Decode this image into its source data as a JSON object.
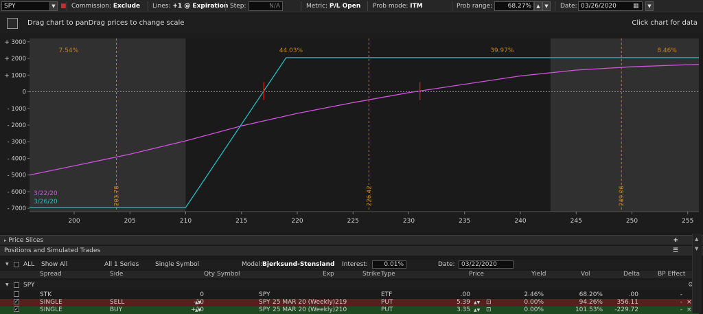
{
  "toolbar": {
    "symbol": "SPY",
    "commission_label": "Commission:",
    "commission_value": "Exclude",
    "lines_label": "Lines:",
    "lines_value": "+1 @ Expiration",
    "step_label": "Step:",
    "step_value": "N/A",
    "metric_label": "Metric:",
    "metric_value": "P/L Open",
    "probmode_label": "Prob mode:",
    "probmode_value": "ITM",
    "probrange_label": "Prob range:",
    "probrange_value": "68.27%",
    "date_label": "Date:",
    "date_value": "03/26/2020"
  },
  "header": {
    "drag_text": "Drag chart to panDrag prices to change scale",
    "click_text": "Click chart for data"
  },
  "chart_data": {
    "type": "line",
    "x_ticks": [
      200,
      205,
      210,
      215,
      220,
      225,
      230,
      235,
      240,
      245,
      250,
      255
    ],
    "y_ticks": [
      "+ 3000",
      "+ 2000",
      "+ 1000",
      "0",
      "- 1000",
      "- 2000",
      "- 3000",
      "- 4000",
      "- 5000",
      "- 6000",
      "- 7000"
    ],
    "y_values": [
      3000,
      2000,
      1000,
      0,
      -1000,
      -2000,
      -3000,
      -4000,
      -5000,
      -6000,
      -7000
    ],
    "xlim": [
      196,
      256
    ],
    "ylim": [
      -7200,
      3200
    ],
    "prob_labels": [
      "7.54%",
      "44.03%",
      "39.97%",
      "8.46%"
    ],
    "vlines": [
      {
        "x": 203.78,
        "label": "203.78"
      },
      {
        "x": 226.42,
        "label": "226.42"
      },
      {
        "x": 249.06,
        "label": "249.06"
      }
    ],
    "series": [
      {
        "name": "3/22/20",
        "color": "#d050e0",
        "x": [
          196,
          200,
          205,
          210,
          215,
          220,
          225,
          230,
          235,
          240,
          245,
          250,
          256
        ],
        "y": [
          -5000,
          -4450,
          -3750,
          -2950,
          -2050,
          -1300,
          -650,
          -50,
          450,
          950,
          1300,
          1500,
          1650
        ]
      },
      {
        "name": "3/26/20",
        "color": "#20c0c0",
        "x": [
          196,
          210,
          219,
          256
        ],
        "y": [
          -6950,
          -6950,
          2050,
          2050
        ]
      }
    ],
    "markers": [
      {
        "x": 217,
        "y": 0
      },
      {
        "x": 231,
        "y": 0
      }
    ]
  },
  "sections": {
    "price_slices": "Price Slices",
    "positions": "Positions and Simulated Trades"
  },
  "filters": {
    "all": "ALL",
    "show_all": "Show All",
    "series": "All 1 Series",
    "symbol": "Single Symbol",
    "model_label": "Model:",
    "model_value": "Bjerksund-Stensland",
    "interest_label": "Interest:",
    "interest_value": "0.01%",
    "date_label": "Date:",
    "date_value": "03/22/2020"
  },
  "columns": [
    "Spread",
    "Side",
    "Qty",
    "Symbol",
    "Exp",
    "Strike",
    "Type",
    "Price",
    "Yield",
    "Vol",
    "Delta",
    "BP Effect"
  ],
  "group": "SPY",
  "rows": [
    {
      "spread": "STK",
      "side": "",
      "qty": "0",
      "symbol": "SPY",
      "exp": "",
      "strike": "",
      "type": "ETF",
      "price": ".00",
      "yield": "2.46%",
      "vol": "68.20%",
      "delta": ".00",
      "bp": "-"
    },
    {
      "spread": "SINGLE",
      "side": "SELL",
      "qty": "-10",
      "symbol": "SPY",
      "exp": "25 MAR 20 (Weekly)",
      "strike": "219",
      "type": "PUT",
      "price": "5.39",
      "yield": "0.00%",
      "vol": "94.26%",
      "delta": "356.11",
      "bp": "-"
    },
    {
      "spread": "SINGLE",
      "side": "BUY",
      "qty": "+10",
      "symbol": "SPY",
      "exp": "25 MAR 20 (Weekly)",
      "strike": "210",
      "type": "PUT",
      "price": "3.35",
      "yield": "0.00%",
      "vol": "101.53%",
      "delta": "-229.72",
      "bp": "-"
    }
  ],
  "colors": {
    "sell_row": "#5a1e1e",
    "buy_row": "#1e4a22",
    "cyan": "#20c0c0",
    "magenta": "#d050e0",
    "orange": "#c8801e"
  }
}
